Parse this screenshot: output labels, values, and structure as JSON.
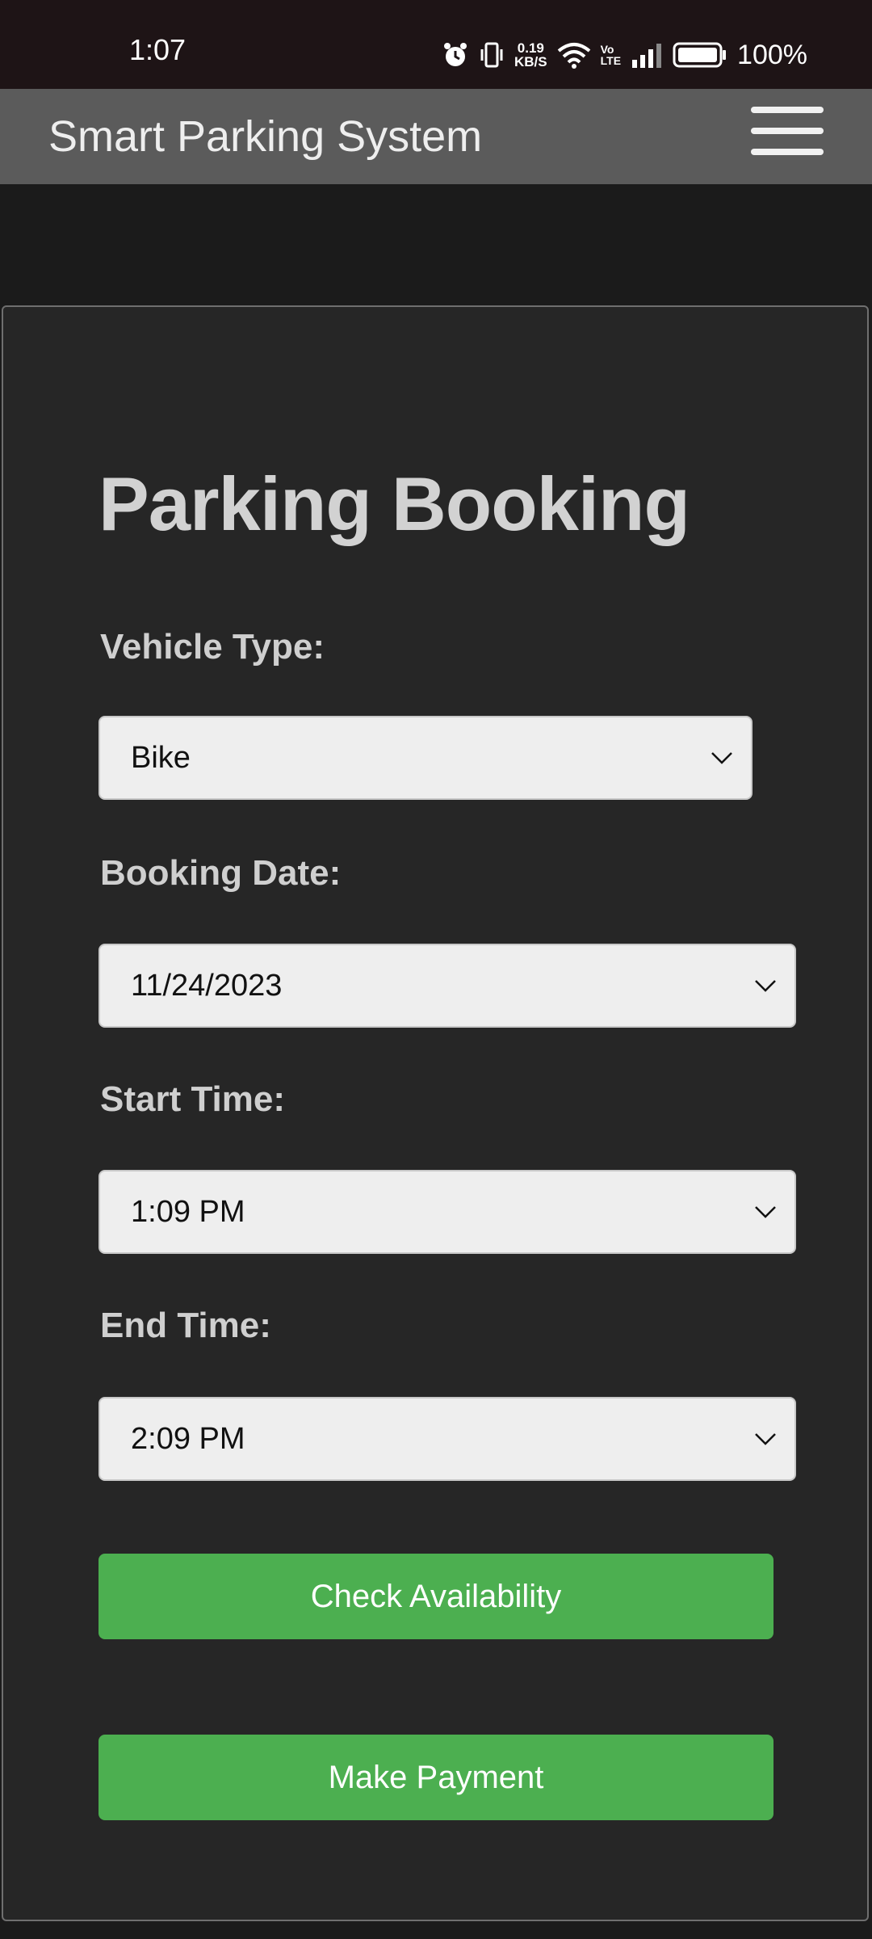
{
  "status_bar": {
    "time": "1:07",
    "speed_value": "0.19",
    "speed_unit": "KB/S",
    "volte_top": "Vo",
    "volte_bottom": "LTE",
    "battery": "100%"
  },
  "header": {
    "title": "Smart Parking System",
    "menu_icon": "hamburger-menu-icon"
  },
  "form": {
    "heading": "Parking Booking",
    "vehicle_type": {
      "label": "Vehicle Type:",
      "value": "Bike"
    },
    "booking_date": {
      "label": "Booking Date:",
      "value": "11/24/2023"
    },
    "start_time": {
      "label": "Start Time:",
      "value": "1:09 PM"
    },
    "end_time": {
      "label": "End Time:",
      "value": "2:09 PM"
    },
    "check_button": "Check Availability",
    "payment_button": "Make Payment"
  },
  "colors": {
    "app_bar": "#5b5b5b",
    "card": "#262626",
    "button": "#4caf50"
  }
}
